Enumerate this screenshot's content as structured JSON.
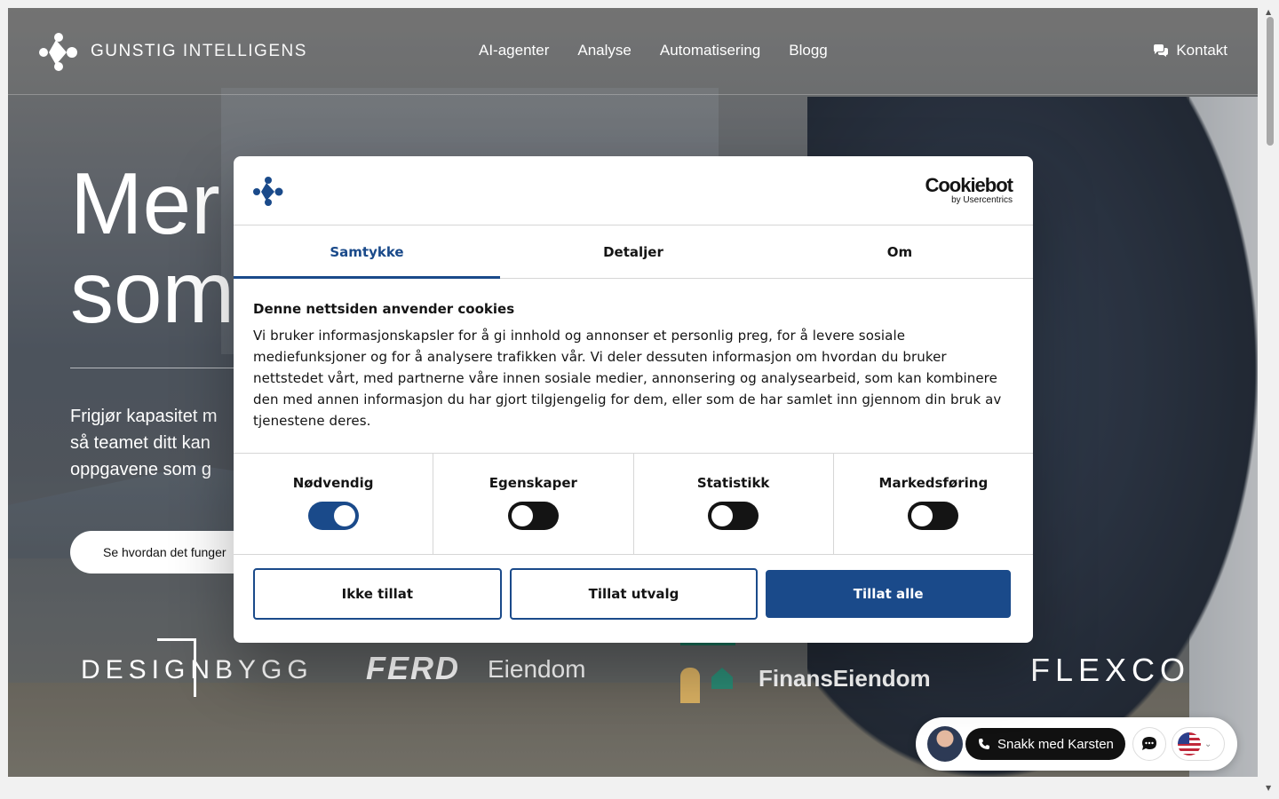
{
  "header": {
    "brand_bold": "GUNSTIG",
    "brand_light": "INTELLIGENS",
    "nav": [
      "AI-agenter",
      "Analyse",
      "Automatisering",
      "Blogg"
    ],
    "contact_label": "Kontakt"
  },
  "hero": {
    "title_line1": "Mer",
    "title_line2": "som",
    "subtitle_lines": [
      "Frigjør kapasitet m",
      "så teamet ditt kan",
      "oppgavene som g"
    ],
    "cta_label": "Se hvordan det funger"
  },
  "client_logos": {
    "designbygg": "DESIGNBYGG",
    "ferd": "FERD",
    "ferd_suffix": "Eiendom",
    "finans": "FinansEiendom",
    "flexco": "FLEXCO"
  },
  "chat_widget": {
    "call_label": "Snakk med Karsten",
    "language": "en-US"
  },
  "cookie_dialog": {
    "brand": "Cookiebot",
    "brand_sub": "by Usercentrics",
    "tabs": [
      "Samtykke",
      "Detaljer",
      "Om"
    ],
    "active_tab": "Samtykke",
    "title": "Denne nettsiden anvender cookies",
    "text": "Vi bruker informasjonskapsler for å gi innhold og annonser et personlig preg, for å levere sosiale mediefunksjoner og for å analysere trafikken vår. Vi deler dessuten informasjon om hvordan du bruker nettstedet vårt, med partnerne våre innen sosiale medier, annonsering og analysearbeid, som kan kombinere den med annen informasjon du har gjort tilgjengelig for dem, eller som de har samlet inn gjennom din bruk av tjenestene deres.",
    "categories": [
      {
        "label": "Nødvendig",
        "enabled": true
      },
      {
        "label": "Egenskaper",
        "enabled": false
      },
      {
        "label": "Statistikk",
        "enabled": false
      },
      {
        "label": "Markedsføring",
        "enabled": false
      }
    ],
    "buttons": {
      "deny": "Ikke tillat",
      "selection": "Tillat utvalg",
      "allow_all": "Tillat alle"
    }
  },
  "colors": {
    "accent": "#1a4a8a",
    "text": "#141414"
  }
}
